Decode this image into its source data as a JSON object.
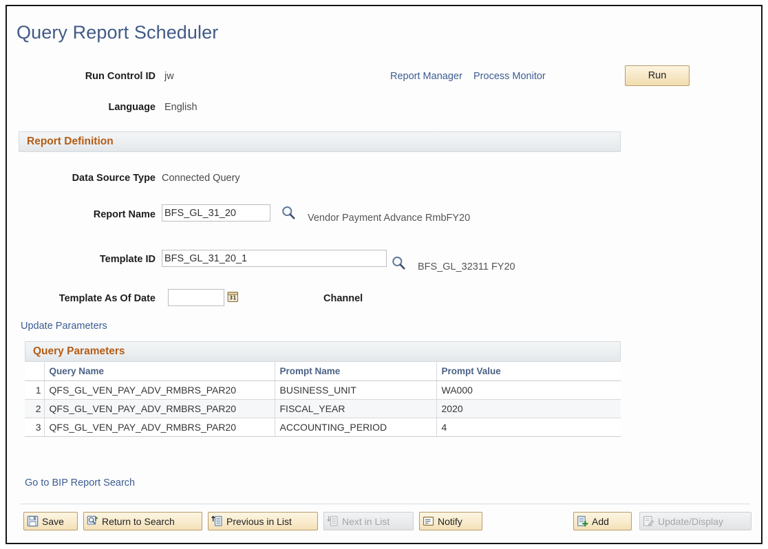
{
  "page": {
    "title": "Query Report Scheduler"
  },
  "header": {
    "run_control_id_label": "Run Control ID",
    "run_control_id_value": "jw",
    "language_label": "Language",
    "language_value": "English",
    "report_manager_link": "Report Manager",
    "process_monitor_link": "Process Monitor",
    "run_button": "Run"
  },
  "report_definition": {
    "section_title": "Report Definition",
    "data_source_type_label": "Data Source Type",
    "data_source_type_value": "Connected Query",
    "report_name_label": "Report Name",
    "report_name_value": "BFS_GL_31_20",
    "report_name_description": "Vendor Payment Advance RmbFY20",
    "template_id_label": "Template ID",
    "template_id_value": "BFS_GL_31_20_1",
    "template_id_description": "BFS_GL_32311 FY20",
    "template_as_of_date_label": "Template As Of Date",
    "template_as_of_date_value": "",
    "channel_label": "Channel",
    "update_parameters_link": "Update Parameters"
  },
  "query_parameters": {
    "section_title": "Query Parameters",
    "columns": [
      "",
      "Query Name",
      "Prompt Name",
      "Prompt Value"
    ],
    "rows": [
      {
        "num": "1",
        "query_name": "QFS_GL_VEN_PAY_ADV_RMBRS_PAR20",
        "prompt_name": "BUSINESS_UNIT",
        "prompt_value": "WA000"
      },
      {
        "num": "2",
        "query_name": "QFS_GL_VEN_PAY_ADV_RMBRS_PAR20",
        "prompt_name": "FISCAL_YEAR",
        "prompt_value": "2020"
      },
      {
        "num": "3",
        "query_name": "QFS_GL_VEN_PAY_ADV_RMBRS_PAR20",
        "prompt_name": "ACCOUNTING_PERIOD",
        "prompt_value": "4"
      }
    ]
  },
  "footer": {
    "bip_search_link": "Go to BIP Report Search",
    "save_button": "Save",
    "return_to_search_button": "Return to Search",
    "previous_in_list_button": "Previous in List",
    "next_in_list_button": "Next in List",
    "notify_button": "Notify",
    "add_button": "Add",
    "update_display_button": "Update/Display"
  },
  "colors": {
    "title_blue": "#415a86",
    "link_blue": "#3d5c91",
    "section_orange": "#b35c15",
    "grid_header_blue": "#4b6186",
    "button_tan": "#f3e0b6",
    "button_border_tan": "#b79b6b"
  }
}
